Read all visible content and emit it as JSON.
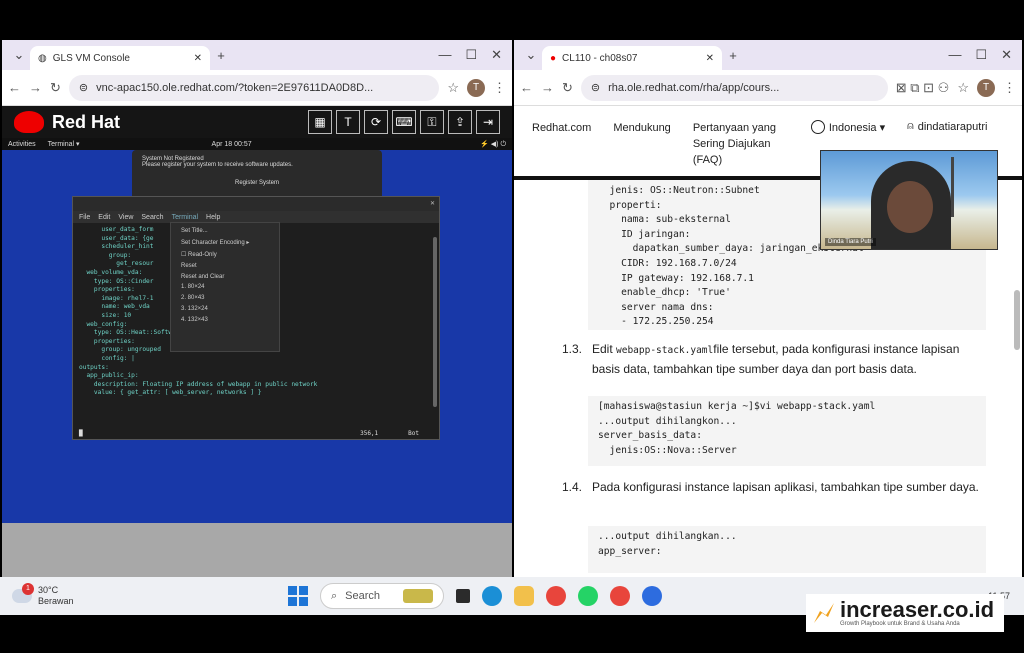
{
  "left_window": {
    "tab_title": "GLS VM Console",
    "url": "vnc-apac150.ole.redhat.com/?token=2E97611DA0D8D...",
    "avatar": "T",
    "brand": "Red Hat",
    "vnc_tools": [
      "T",
      "⟳",
      "⌨",
      "⚿",
      "⇪",
      "⇥"
    ],
    "gnome": {
      "activities": "Activities",
      "app": "Terminal ▾",
      "clock": "Apr 18 00:57"
    },
    "notification": {
      "title": "System Not Registered",
      "body": "Please register your system to receive software updates.",
      "button": "Register System"
    },
    "terminal": {
      "menu": [
        "File",
        "Edit",
        "View",
        "Search",
        "Terminal",
        "Help"
      ],
      "lines": [
        "      user_data_form",
        "      user_data: {ge",
        "      scheduler_hint",
        "        group:",
        "          get_resour",
        "",
        "  web_volume_vda:",
        "    type: OS::Cinder",
        "    properties:",
        "      image: rhel7-1",
        "      name: web_vda",
        "      size: 10",
        "",
        "  web_config:",
        "    type: OS::Heat::SoftwareConfig",
        "    properties:",
        "      group: ungrouped",
        "      config: |",
        "",
        "outputs:",
        "  app_public_ip:",
        "    description: Floating IP address of webapp in public network",
        "    value: { get_attr: [ web_server, networks ] }"
      ],
      "status_pos": "356,1",
      "status_end": "Bot",
      "context_menu": [
        "Set Title...",
        "Set Character Encoding  ▸",
        "☐ Read-Only",
        "Reset",
        "Reset and Clear",
        "1. 80×24",
        "2. 80×43",
        "3. 132×24",
        "4. 132×43"
      ]
    }
  },
  "right_window": {
    "tab_title": "CL110 - ch08s07",
    "url": "rha.ole.redhat.com/rha/app/cours...",
    "avatar": "T",
    "nav": {
      "home": "Redhat.com",
      "support": "Mendukung",
      "faq": "Pertanyaan yang Sering Diajukan (FAQ)",
      "language": "Indonesia ▾",
      "user": "dindatiaraputri"
    },
    "code1": "  jenis: OS::Neutron::Subnet\n  properti:\n    nama: sub-eksternal\n    ID jaringan:\n      dapatkan_sumber_daya: jaringan_eksternal\n    CIDR: 192.168.7.0/24\n    IP gateway: 192.168.7.1\n    enable_dhcp: 'True'\n    server nama dns:\n    - 172.25.250.254",
    "step1": {
      "num": "1.3.",
      "pre": "Edit ",
      "code": "webapp-stack.yaml",
      "post": "file tersebut, pada konfigurasi instance lapisan basis data, tambahkan tipe sumber daya dan port basis data."
    },
    "code2": "[mahasiswa@stasiun kerja ~]$vi webapp-stack.yaml\n...output dihilangkon...\nserver_basis_data:\n  jenis:OS::Nova::Server",
    "step2": {
      "num": "1.4.",
      "text": "Pada konfigurasi instance lapisan aplikasi, tambahkan tipe sumber daya."
    },
    "code3": "...output dihilangkan...\napp_server:",
    "webcam_name": "Dinda Tiara Putri"
  },
  "taskbar": {
    "temp": "30°C",
    "weather": "Berawan",
    "weather_badge": "1",
    "search": "Search",
    "time": "11:57"
  },
  "watermark": {
    "brand": "increaser.co.id",
    "tagline": "Growth Playbook untuk Brand & Usaha Anda"
  }
}
